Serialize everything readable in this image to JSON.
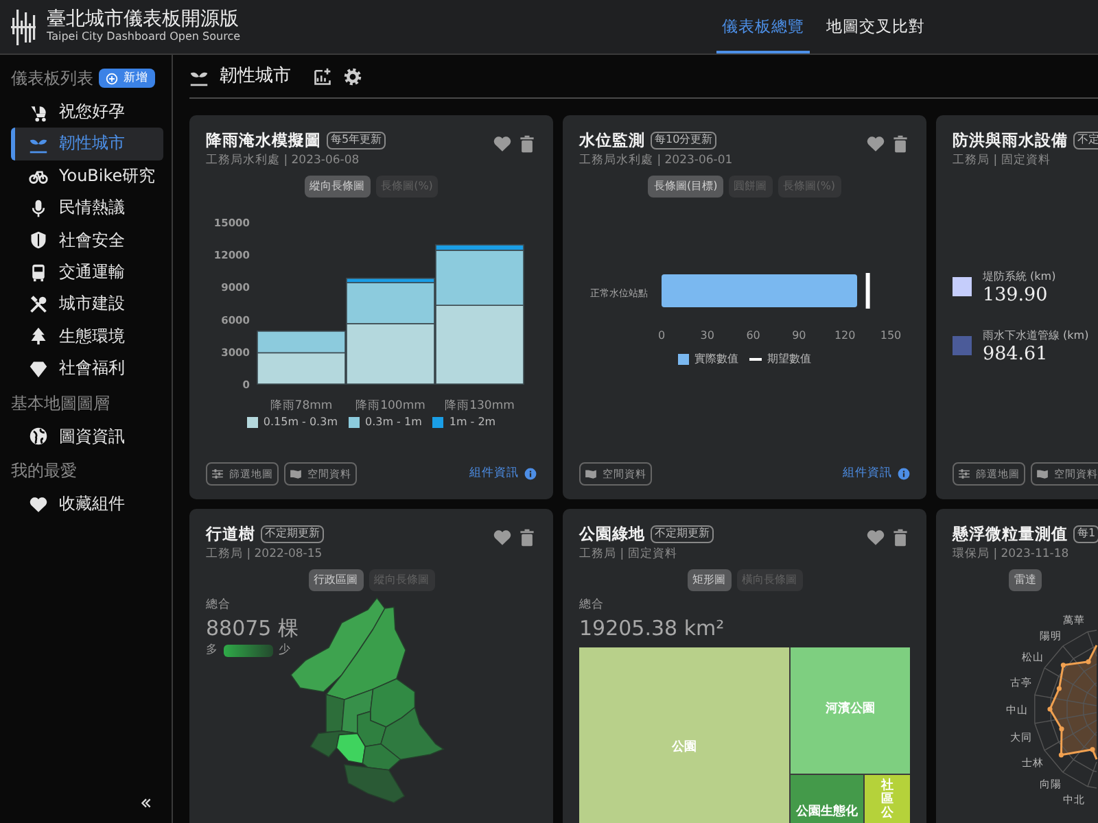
{
  "header": {
    "title": "臺北城市儀表板開源版",
    "subtitle": "Taipei City Dashboard Open Source",
    "nav": [
      {
        "label": "儀表板總覽",
        "selected": true
      },
      {
        "label": "地圖交叉比對",
        "selected": false
      }
    ]
  },
  "sidebar": {
    "sections": [
      {
        "title": "儀表板列表",
        "add_button": "新增",
        "items": [
          {
            "label": "祝您好孕",
            "selected": false
          },
          {
            "label": "韌性城市",
            "selected": true
          },
          {
            "label": "YouBike研究",
            "selected": false
          },
          {
            "label": "民情熱議",
            "selected": false
          },
          {
            "label": "社會安全",
            "selected": false
          },
          {
            "label": "交通運輸",
            "selected": false
          },
          {
            "label": "城市建設",
            "selected": false
          },
          {
            "label": "生態環境",
            "selected": false
          },
          {
            "label": "社會福利",
            "selected": false
          }
        ]
      },
      {
        "title": "基本地圖圖層",
        "items": [
          {
            "label": "圖資資訊",
            "selected": false
          }
        ]
      },
      {
        "title": "我的最愛",
        "items": [
          {
            "label": "收藏組件",
            "selected": false
          }
        ]
      }
    ]
  },
  "dashboard": {
    "title": "韌性城市"
  },
  "cards": [
    {
      "kind": "stacked_bar",
      "title": "降雨淹水模擬圖",
      "badge": "每5年更新",
      "source": "工務局水利處 | 2023-06-08",
      "actions_visible": true,
      "toggles": [
        {
          "label": "縱向長條圖",
          "selected": true
        },
        {
          "label": "長條圖(%)",
          "selected": false
        }
      ],
      "chart_data": {
        "type": "bar",
        "stacked": true,
        "legend": "bottom",
        "categories": [
          "降雨78mm",
          "降雨100mm",
          "降雨130mm"
        ],
        "ylim": [
          0,
          15000
        ],
        "yticks": [
          0,
          3000,
          6000,
          9000,
          12000,
          15000
        ],
        "series": [
          {
            "name": "0.15m - 0.3m",
            "color": "#b4d8dd",
            "values": [
              2900,
              5600,
              7300
            ]
          },
          {
            "name": "0.3m - 1m",
            "color": "#8ccbdd",
            "values": [
              2000,
              3800,
              5100
            ]
          },
          {
            "name": "1m - 2m",
            "color": "#1a9ee6",
            "values": [
              null,
              400,
              500
            ]
          }
        ]
      },
      "footer_buttons": [
        {
          "kind": "filter",
          "label": "篩選地圖"
        },
        {
          "kind": "map",
          "label": "空間資料"
        }
      ],
      "info_link": "組件資訊"
    },
    {
      "kind": "bullet_bar",
      "title": "水位監測",
      "badge": "每10分更新",
      "source": "工務局水利處 | 2023-06-01",
      "actions_visible": true,
      "toggles": [
        {
          "label": "長條圖(目標)",
          "selected": true
        },
        {
          "label": "圓餅圖",
          "selected": false
        },
        {
          "label": "長條圖(%)",
          "selected": false
        }
      ],
      "chart_data": {
        "type": "bar",
        "orientation": "horizontal",
        "legend": "bottom",
        "categories": [
          "正常水位站點"
        ],
        "xlim": [
          0,
          150
        ],
        "xticks": [
          0,
          30,
          60,
          90,
          120,
          150
        ],
        "series": [
          {
            "name": "實際數值",
            "color": "#7ab8f0",
            "values": [
              128
            ]
          }
        ],
        "ref_lines": [
          {
            "axis": "x",
            "value": 135,
            "label": "期望數值",
            "color": "#ffffff"
          }
        ]
      },
      "footer_buttons": [
        {
          "kind": "map",
          "label": "空間資料"
        }
      ],
      "info_link": "組件資訊"
    },
    {
      "kind": "legend_stats",
      "title": "防洪與雨水設備",
      "badge": "不定",
      "source": "工務局 | 固定資料",
      "actions_visible": false,
      "items": [
        {
          "label": "堤防系統 (km)",
          "value": "139.90",
          "color": "#c5cdfb"
        },
        {
          "label": "雨水下水道管線 (km)",
          "value": "984.61",
          "color": "#4b5b99"
        }
      ],
      "footer_buttons": [
        {
          "kind": "filter",
          "label": "篩選地圖"
        },
        {
          "kind": "map",
          "label": "空間資料"
        }
      ]
    },
    {
      "kind": "district_map",
      "title": "行道樹",
      "badge": "不定期更新",
      "source": "工務局 | 2022-08-15",
      "actions_visible": true,
      "toggles": [
        {
          "label": "行政區圖",
          "selected": true
        },
        {
          "label": "縱向長條圖",
          "selected": false
        }
      ],
      "total_label": "總合",
      "total": "88075 棵",
      "scale": {
        "high": "多",
        "low": "少"
      }
    },
    {
      "kind": "treemap",
      "title": "公園綠地",
      "badge": "不定期更新",
      "source": "工務局 | 固定資料",
      "actions_visible": true,
      "toggles": [
        {
          "label": "矩形圖",
          "selected": true
        },
        {
          "label": "橫向長條圖",
          "selected": false
        }
      ],
      "total_label": "總合",
      "total": "19205.38 km²",
      "tiles": [
        {
          "label": "公園",
          "color": "#b8d08a"
        },
        {
          "label": "河濱公園",
          "color": "#7ecf80"
        },
        {
          "label": "公園生態化",
          "color": "#449a4a"
        },
        {
          "label": "社區公",
          "color": "#b5d23a"
        }
      ]
    },
    {
      "kind": "radar",
      "title": "懸浮微粒量測值",
      "badge": "每1",
      "source": "環保局 | 2023-11-18",
      "actions_visible": false,
      "toggles": [
        {
          "label": "雷達",
          "selected": true
        }
      ],
      "axis_labels": [
        "萬華",
        "陽明",
        "松山",
        "古亭",
        "中山",
        "大同",
        "士林",
        "向陽",
        "中北"
      ]
    }
  ]
}
